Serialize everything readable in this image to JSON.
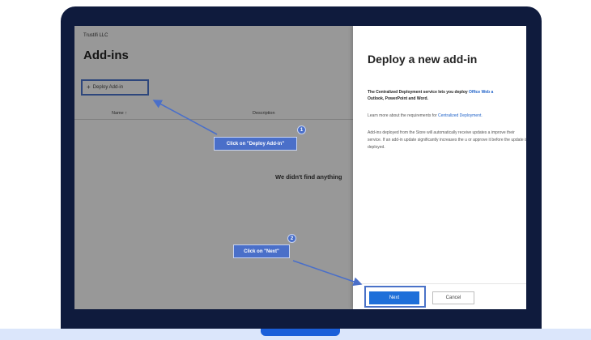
{
  "admin": {
    "org_name": "Trustifi LLC",
    "page_title": "Add-ins",
    "deploy_button": "Deploy Add-in",
    "columns": {
      "name": "Name ↑",
      "description": "Description"
    },
    "empty_message": "We didn't find anything"
  },
  "panel": {
    "title": "Deploy a new add-in",
    "intro_text": "The Centralized Deployment service lets you deploy ",
    "intro_link": "Office Web a",
    "intro_tail": "Outlook, PowerPoint and Word.",
    "learn_text": "Learn more about the requirements for ",
    "learn_link": "Centralized Deployment.",
    "store_note": "Add-ins deployed from the Store will automatically receive updates a improve their service. If an add-in update significantly increases the u or approve it before the update is deployed.",
    "next_label": "Next",
    "cancel_label": "Cancel"
  },
  "callouts": [
    {
      "step": "1",
      "text": "Click on \"Deploy Add-in\""
    },
    {
      "step": "2",
      "text": "Click on \"Next\""
    }
  ],
  "colors": {
    "bezel": "#0f1b3d",
    "accent": "#4a6fc9",
    "primary_button": "#1e6fd9",
    "link": "#1e61c8",
    "base": "#dbe6fb",
    "notch": "#1b5fd9"
  },
  "icons": {
    "deploy_plus": "plus-icon",
    "callout_arrow": "arrow-icon"
  }
}
